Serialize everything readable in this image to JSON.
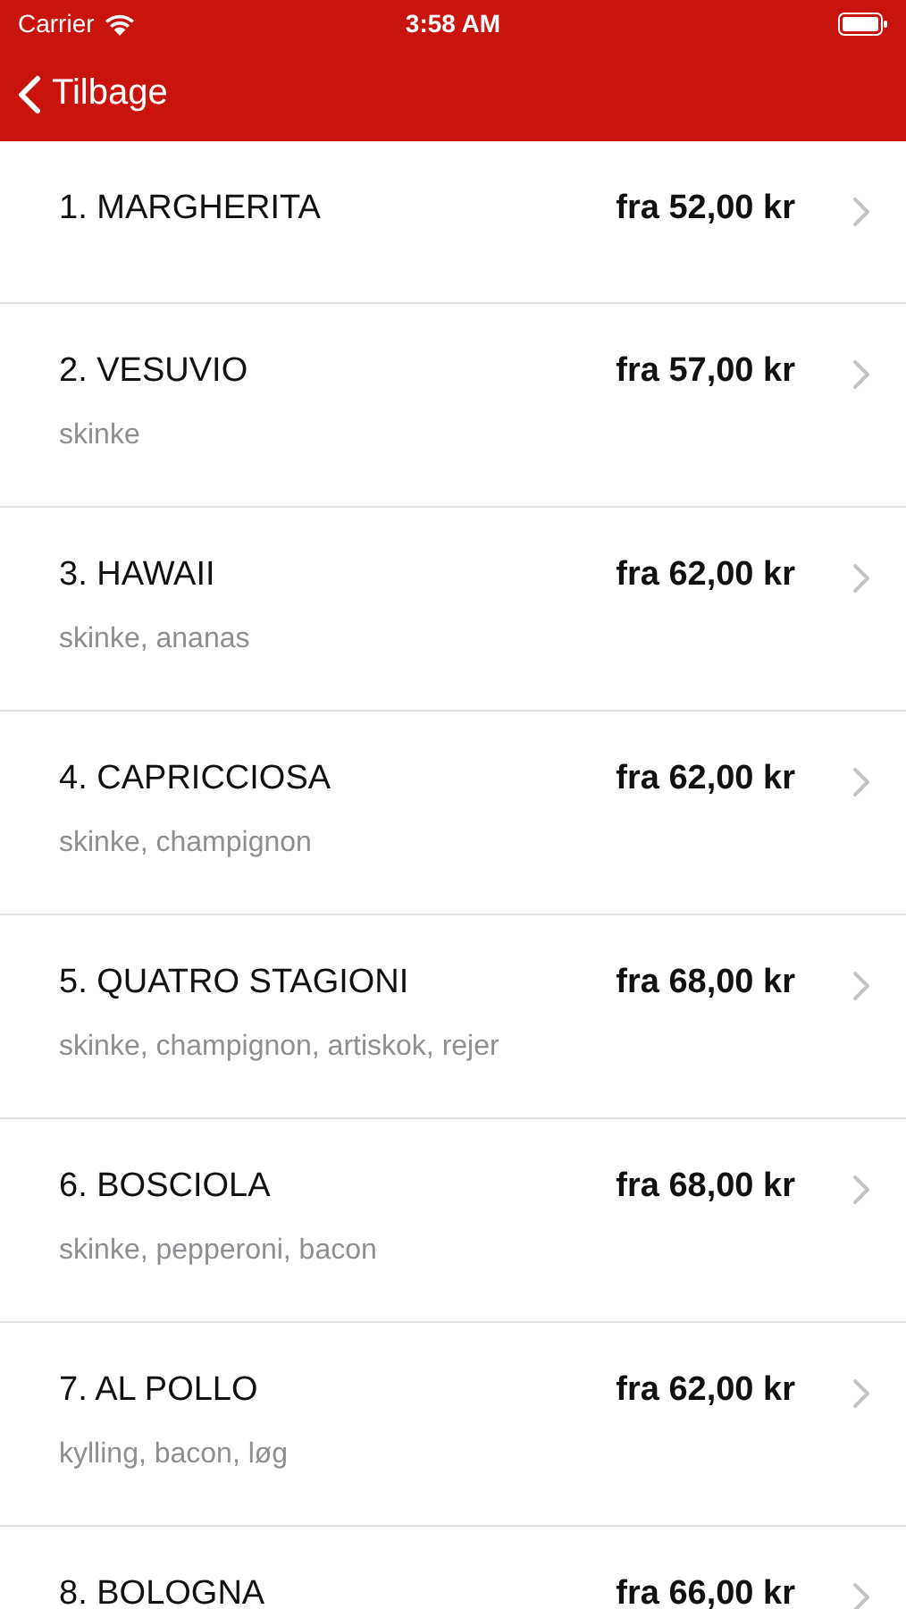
{
  "status_bar": {
    "carrier": "Carrier",
    "time": "3:58 AM"
  },
  "nav_bar": {
    "back_label": "Tilbage"
  },
  "items": [
    {
      "name": "1. MARGHERITA",
      "price": "fra 52,00 kr"
    },
    {
      "name": "2. VESUVIO",
      "price": "fra 57,00 kr",
      "description": "skinke"
    },
    {
      "name": "3. HAWAII",
      "price": "fra 62,00 kr",
      "description": "skinke, ananas"
    },
    {
      "name": "4. CAPRICCIOSA",
      "price": "fra 62,00 kr",
      "description": "skinke, champignon"
    },
    {
      "name": "5. QUATRO STAGIONI",
      "price": "fra 68,00 kr",
      "description": "skinke, champignon, artiskok, rejer"
    },
    {
      "name": "6. BOSCIOLA",
      "price": "fra 68,00 kr",
      "description": "skinke, pepperoni, bacon"
    },
    {
      "name": "7. AL POLLO",
      "price": "fra 62,00 kr",
      "description": "kylling, bacon, løg"
    },
    {
      "name": "8. BOLOGNA",
      "price": "fra 66,00 kr"
    }
  ]
}
